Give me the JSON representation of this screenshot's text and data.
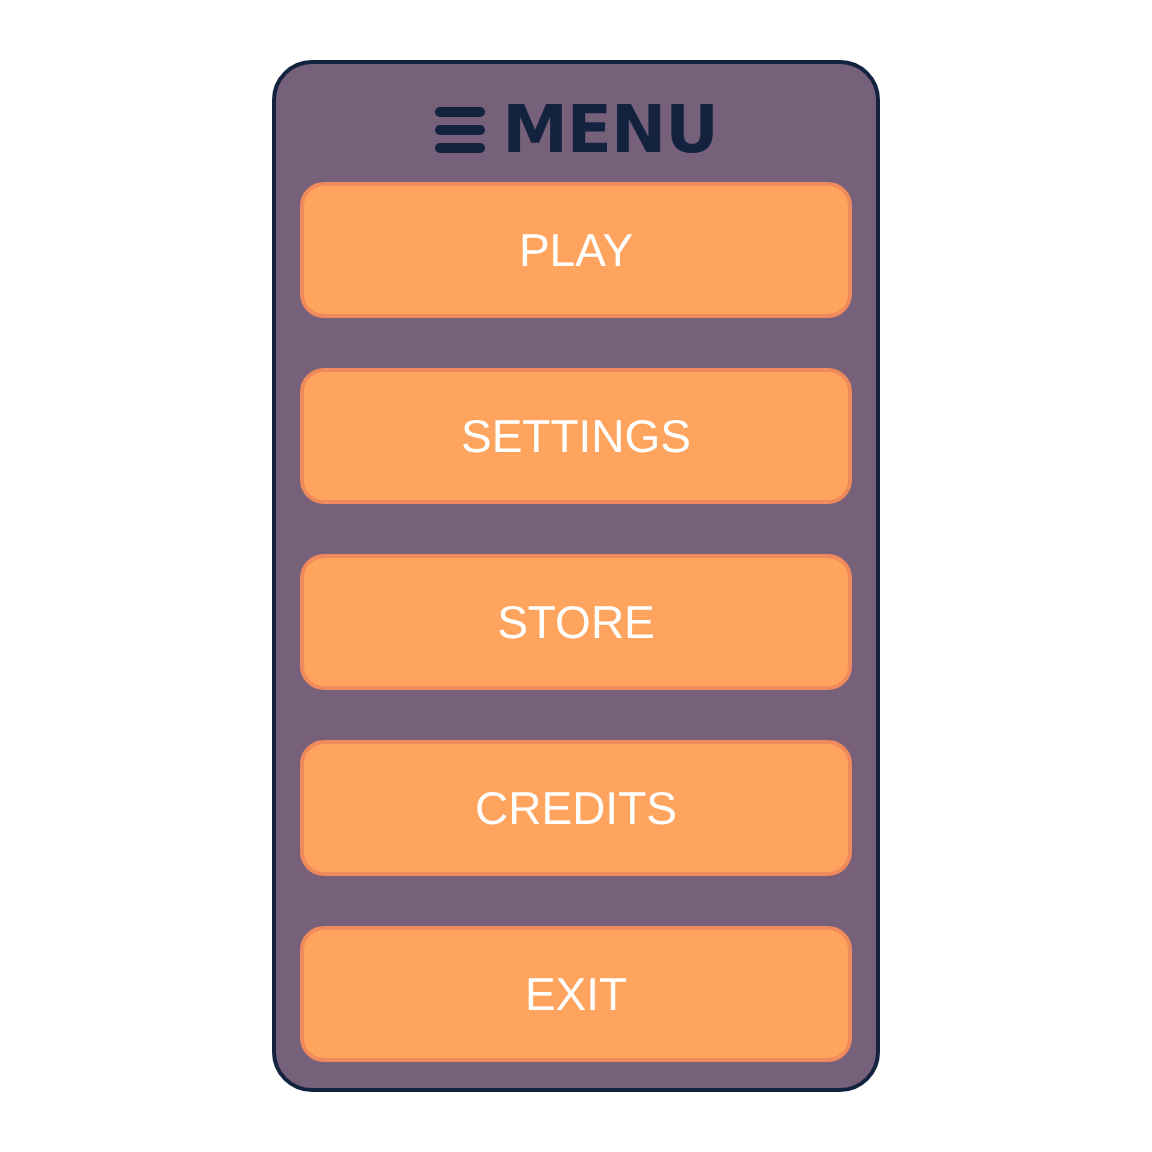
{
  "menu": {
    "title": "MENU",
    "buttons": [
      {
        "label": "PLAY"
      },
      {
        "label": "SETTINGS"
      },
      {
        "label": "STORE"
      },
      {
        "label": "CREDITS"
      },
      {
        "label": "EXIT"
      }
    ]
  }
}
